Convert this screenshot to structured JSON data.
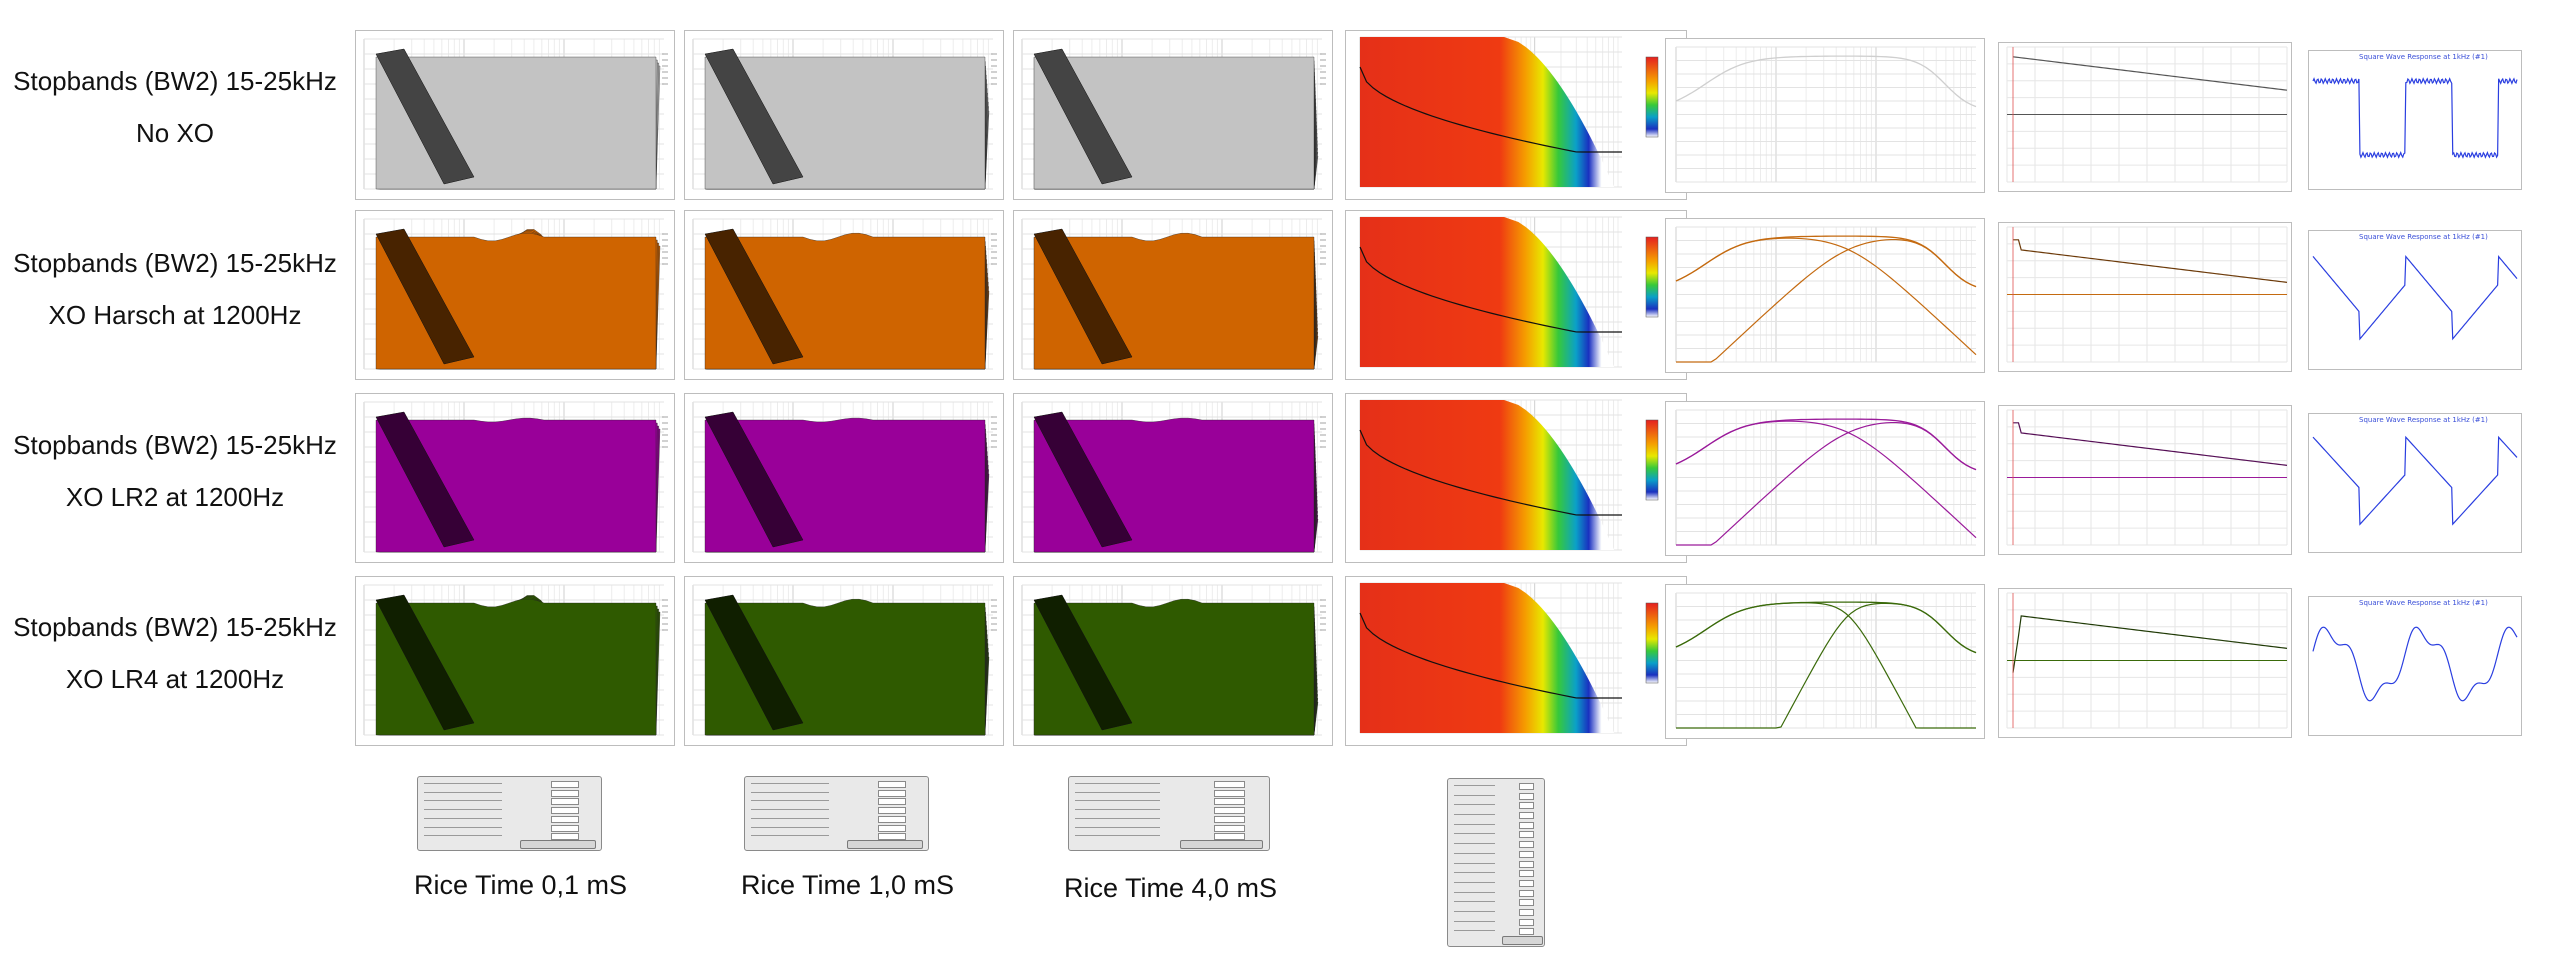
{
  "rows": [
    {
      "line1": "Stopbands (BW2) 15-25kHz",
      "line2": "No XO",
      "color": "#c3c3c3",
      "line_color": "#9a9a9a"
    },
    {
      "line1": "Stopbands (BW2) 15-25kHz",
      "line2": "XO Harsch at 1200Hz",
      "color": "#cf6400",
      "line_color": "#c46a10"
    },
    {
      "line1": "Stopbands (BW2) 15-25kHz",
      "line2": "XO LR2 at 1200Hz",
      "color": "#990099",
      "line_color": "#9a1a9a"
    },
    {
      "line1": "Stopbands (BW2) 15-25kHz",
      "line2": "XO LR4 at 1200Hz",
      "color": "#2f5a00",
      "line_color": "#3a6a0a"
    }
  ],
  "captions": [
    "Rice Time 0,1 mS",
    "Rice Time 1,0 mS",
    "Rice Time 4,0 mS"
  ],
  "square_wave_title": "Square Wave Response at 1kHz (#1)",
  "chart_data": [
    {
      "type": "area",
      "name": "cumulative-spectral-decay",
      "xaxis": "log frequency",
      "columns": 3,
      "rows": 4
    },
    {
      "type": "heatmap",
      "name": "spectrogram",
      "xaxis": "log frequency"
    },
    {
      "type": "line",
      "name": "magnitude-response",
      "xaxis": "log frequency",
      "series": [
        {
          "row": 1,
          "x": [
            20,
            200,
            1000,
            5000,
            15000,
            25000
          ],
          "y": [
            60,
            110,
            112,
            112,
            110,
            60
          ]
        },
        {
          "row": 2,
          "x": [
            20,
            200,
            1000,
            1200,
            3000,
            15000,
            25000
          ],
          "y": [
            60,
            110,
            112,
            100,
            112,
            110,
            60
          ]
        },
        {
          "row": 3,
          "x": [
            20,
            200,
            1000,
            1200,
            3000,
            15000,
            25000
          ],
          "y": [
            60,
            110,
            112,
            104,
            112,
            110,
            60
          ]
        },
        {
          "row": 4,
          "x": [
            20,
            200,
            1000,
            1200,
            3000,
            15000,
            25000
          ],
          "y": [
            60,
            110,
            112,
            106,
            112,
            110,
            60
          ]
        }
      ]
    },
    {
      "type": "line",
      "name": "impulse-response",
      "xaxis": "time"
    },
    {
      "type": "line",
      "name": "square-wave-response",
      "xaxis": "time"
    }
  ]
}
